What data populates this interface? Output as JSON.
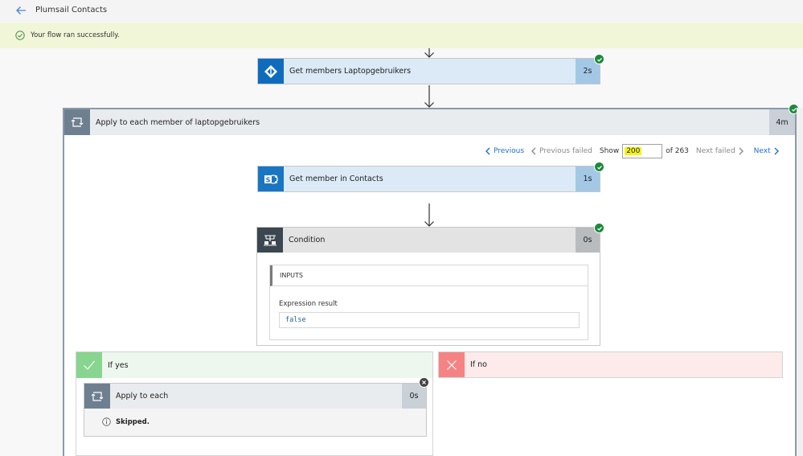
{
  "header": {
    "back_icon": "arrow-left-icon",
    "title": "Plumsail Contacts"
  },
  "banner": {
    "icon": "check-circle-icon",
    "text": "Your flow ran successfully."
  },
  "colors": {
    "success_green": "#1b8a3a",
    "link_blue": "#1f6fc5",
    "azure_ad_blue": "#0f6cbd",
    "sharepoint_blue": "#1976c2",
    "loop_gray": "#6e7f90",
    "condition_dark": "#3b4650",
    "yes_green": "#88d58f",
    "no_red": "#f68383",
    "highlight_yellow": "#f6f31b"
  },
  "flow": {
    "get_members": {
      "icon": "azure-ad-icon",
      "title": "Get members Laptopgebruikers",
      "duration": "2s",
      "status": "succeeded"
    },
    "apply_to_each": {
      "icon": "loop-icon",
      "title": "Apply to each member of laptopgebruikers",
      "duration": "4m",
      "status": "succeeded",
      "pager": {
        "previous": "Previous",
        "previous_failed": "Previous failed",
        "show_label": "Show",
        "current": "200",
        "of_label": "of 263",
        "next_failed": "Next failed",
        "next": "Next"
      }
    },
    "get_member_contacts": {
      "icon": "sharepoint-icon",
      "title": "Get member in Contacts",
      "duration": "1s",
      "status": "succeeded"
    },
    "condition": {
      "icon": "condition-icon",
      "title": "Condition",
      "duration": "0s",
      "status": "succeeded",
      "inputs_label": "INPUTS",
      "expression_label": "Expression result",
      "expression_value": "false"
    },
    "if_yes": {
      "icon": "check-icon",
      "title": "If yes",
      "inner": {
        "icon": "loop-icon",
        "title": "Apply to each",
        "duration": "0s",
        "status": "skipped",
        "message": "Skipped."
      }
    },
    "if_no": {
      "icon": "close-icon",
      "title": "If no"
    }
  }
}
